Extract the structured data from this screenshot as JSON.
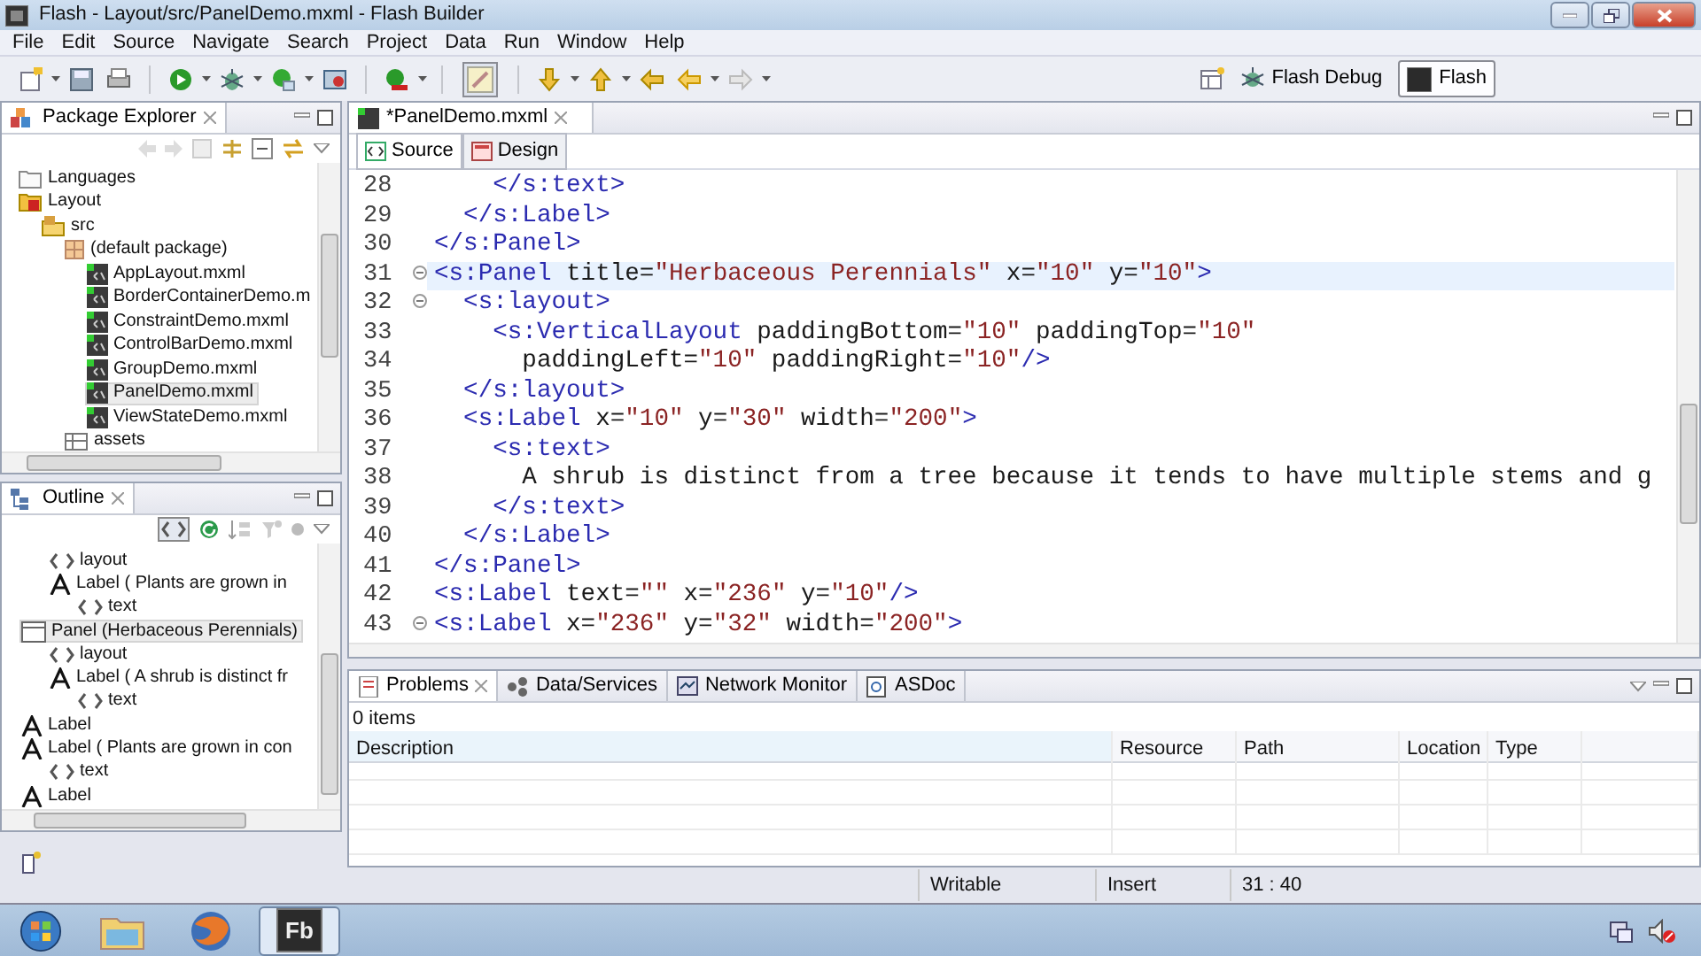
{
  "window": {
    "title": "Flash - Layout/src/PanelDemo.mxml - Flash Builder"
  },
  "menu": [
    "File",
    "Edit",
    "Source",
    "Navigate",
    "Search",
    "Project",
    "Data",
    "Run",
    "Window",
    "Help"
  ],
  "perspectives": [
    {
      "label": "Flash Debug",
      "kind": "debug",
      "selected": false
    },
    {
      "label": "Flash",
      "kind": "flash",
      "selected": true
    }
  ],
  "package_explorer": {
    "title": "Package Explorer",
    "items": [
      {
        "label": "Languages",
        "kind": "folder",
        "selected": false
      },
      {
        "label": "Layout",
        "kind": "project",
        "selected": false,
        "children": [
          {
            "label": "src",
            "kind": "source-folder",
            "selected": false,
            "children": [
              {
                "label": "(default package)",
                "kind": "package",
                "selected": false,
                "children": [
                  {
                    "label": "AppLayout.mxml",
                    "kind": "mxml",
                    "selected": false
                  },
                  {
                    "label": "BorderContainerDemo.m",
                    "kind": "mxml",
                    "selected": false
                  },
                  {
                    "label": "ConstraintDemo.mxml",
                    "kind": "mxml",
                    "selected": false
                  },
                  {
                    "label": "ControlBarDemo.mxml",
                    "kind": "mxml",
                    "selected": false
                  },
                  {
                    "label": "GroupDemo.mxml",
                    "kind": "mxml",
                    "selected": false
                  },
                  {
                    "label": "PanelDemo.mxml",
                    "kind": "mxml",
                    "selected": true
                  },
                  {
                    "label": "ViewStateDemo.mxml",
                    "kind": "mxml",
                    "selected": false
                  }
                ]
              },
              {
                "label": "assets",
                "kind": "assets",
                "selected": false
              }
            ]
          }
        ]
      }
    ]
  },
  "outline": {
    "title": "Outline",
    "items": [
      {
        "children": [
          {
            "label": "layout",
            "kind": "tag",
            "selected": false
          },
          {
            "label": "Label ( Plants are grown in",
            "kind": "label",
            "selected": false,
            "children": [
              {
                "label": "text",
                "kind": "tag",
                "selected": false
              }
            ]
          }
        ]
      },
      {
        "label": "Panel (Herbaceous Perennials)",
        "kind": "panel",
        "selected": true,
        "children": [
          {
            "label": "layout",
            "kind": "tag",
            "selected": false
          },
          {
            "label": "Label ( A shrub is distinct fr",
            "kind": "label",
            "selected": false,
            "children": [
              {
                "label": "text",
                "kind": "tag",
                "selected": false
              }
            ]
          }
        ]
      },
      {
        "label": "Label",
        "kind": "label",
        "selected": false
      },
      {
        "label": "Label ( Plants are grown in con",
        "kind": "label",
        "selected": false,
        "children": [
          {
            "label": "text",
            "kind": "tag",
            "selected": false
          }
        ]
      },
      {
        "label": "Label",
        "kind": "label",
        "selected": false
      }
    ]
  },
  "editor": {
    "tabs": [
      {
        "label": "*PanelDemo.mxml",
        "selected": true
      }
    ],
    "modes": [
      {
        "label": "Source",
        "kind": "source",
        "selected": true
      },
      {
        "label": "Design",
        "kind": "design",
        "selected": false
      }
    ],
    "lines": [
      {
        "number": "28",
        "current": false,
        "foldable": false,
        "tokens": [
          {
            "kind": "tag",
            "text": "    </s:text>"
          }
        ]
      },
      {
        "number": "29",
        "current": false,
        "foldable": false,
        "tokens": [
          {
            "kind": "tag",
            "text": "  </s:Label>"
          }
        ]
      },
      {
        "number": "30",
        "current": false,
        "foldable": false,
        "tokens": [
          {
            "kind": "tag",
            "text": "</s:Panel>"
          }
        ]
      },
      {
        "number": "31",
        "current": true,
        "foldable": true,
        "tokens": [
          {
            "kind": "tag",
            "text": "<s:Panel"
          },
          {
            "kind": "attr",
            "text": " title="
          },
          {
            "kind": "value",
            "text": "\"Herbaceous Perennials\""
          },
          {
            "kind": "attr",
            "text": " x="
          },
          {
            "kind": "value",
            "text": "\"10\""
          },
          {
            "kind": "attr",
            "text": " y="
          },
          {
            "kind": "value",
            "text": "\"10\""
          },
          {
            "kind": "tag",
            "text": ">"
          }
        ]
      },
      {
        "number": "32",
        "current": false,
        "foldable": true,
        "tokens": [
          {
            "kind": "tag",
            "text": "  <s:layout>"
          }
        ]
      },
      {
        "number": "33",
        "current": false,
        "foldable": false,
        "tokens": [
          {
            "kind": "tag",
            "text": "    <s:VerticalLayout"
          },
          {
            "kind": "attr",
            "text": " paddingBottom="
          },
          {
            "kind": "value",
            "text": "\"10\""
          },
          {
            "kind": "attr",
            "text": " paddingTop="
          },
          {
            "kind": "value",
            "text": "\"10\""
          }
        ]
      },
      {
        "number": "34",
        "current": false,
        "foldable": false,
        "tokens": [
          {
            "kind": "attr",
            "text": "      paddingLeft="
          },
          {
            "kind": "value",
            "text": "\"10\""
          },
          {
            "kind": "attr",
            "text": " paddingRight="
          },
          {
            "kind": "value",
            "text": "\"10\""
          },
          {
            "kind": "tag",
            "text": "/>"
          }
        ]
      },
      {
        "number": "35",
        "current": false,
        "foldable": false,
        "tokens": [
          {
            "kind": "tag",
            "text": "  </s:layout>"
          }
        ]
      },
      {
        "number": "36",
        "current": false,
        "foldable": false,
        "tokens": [
          {
            "kind": "tag",
            "text": "  <s:Label"
          },
          {
            "kind": "attr",
            "text": " x="
          },
          {
            "kind": "value",
            "text": "\"10\""
          },
          {
            "kind": "attr",
            "text": " y="
          },
          {
            "kind": "value",
            "text": "\"30\""
          },
          {
            "kind": "attr",
            "text": " width="
          },
          {
            "kind": "value",
            "text": "\"200\""
          },
          {
            "kind": "tag",
            "text": ">"
          }
        ]
      },
      {
        "number": "37",
        "current": false,
        "foldable": false,
        "tokens": [
          {
            "kind": "tag",
            "text": "    <s:text>"
          }
        ]
      },
      {
        "number": "38",
        "current": false,
        "foldable": false,
        "tokens": [
          {
            "kind": "text",
            "text": "      A shrub is distinct from a tree because it tends to have multiple stems and g"
          }
        ]
      },
      {
        "number": "39",
        "current": false,
        "foldable": false,
        "tokens": [
          {
            "kind": "tag",
            "text": "    </s:text>"
          }
        ]
      },
      {
        "number": "40",
        "current": false,
        "foldable": false,
        "tokens": [
          {
            "kind": "tag",
            "text": "  </s:Label>"
          }
        ]
      },
      {
        "number": "41",
        "current": false,
        "foldable": false,
        "tokens": [
          {
            "kind": "tag",
            "text": "</s:Panel>"
          }
        ]
      },
      {
        "number": "42",
        "current": false,
        "foldable": false,
        "tokens": [
          {
            "kind": "tag",
            "text": "<s:Label"
          },
          {
            "kind": "attr",
            "text": " text="
          },
          {
            "kind": "value",
            "text": "\"\""
          },
          {
            "kind": "attr",
            "text": " x="
          },
          {
            "kind": "value",
            "text": "\"236\""
          },
          {
            "kind": "attr",
            "text": " y="
          },
          {
            "kind": "value",
            "text": "\"10\""
          },
          {
            "kind": "tag",
            "text": "/>"
          }
        ]
      },
      {
        "number": "43",
        "current": false,
        "foldable": true,
        "tokens": [
          {
            "kind": "tag",
            "text": "<s:Label"
          },
          {
            "kind": "attr",
            "text": " x="
          },
          {
            "kind": "value",
            "text": "\"236\""
          },
          {
            "kind": "attr",
            "text": " y="
          },
          {
            "kind": "value",
            "text": "\"32\""
          },
          {
            "kind": "attr",
            "text": " width="
          },
          {
            "kind": "value",
            "text": "\"200\""
          },
          {
            "kind": "tag",
            "text": ">"
          }
        ]
      }
    ]
  },
  "problems": {
    "tabs": [
      {
        "label": "Problems",
        "kind": "problems",
        "selected": true
      },
      {
        "label": "Data/Services",
        "kind": "data",
        "selected": false
      },
      {
        "label": "Network Monitor",
        "kind": "network",
        "selected": false
      },
      {
        "label": "ASDoc",
        "kind": "asdoc",
        "selected": false
      }
    ],
    "summary": "0 items",
    "columns": [
      "Description",
      "Resource",
      "Path",
      "Location",
      "Type"
    ]
  },
  "status_bar": [
    "Writable",
    "Insert",
    "31 : 40"
  ],
  "taskbar": {
    "apps": [
      {
        "kind": "start",
        "selected": false
      },
      {
        "kind": "folder",
        "selected": false
      },
      {
        "kind": "browser",
        "selected": false
      },
      {
        "kind": "app",
        "label": "Fb",
        "selected": true
      }
    ]
  }
}
